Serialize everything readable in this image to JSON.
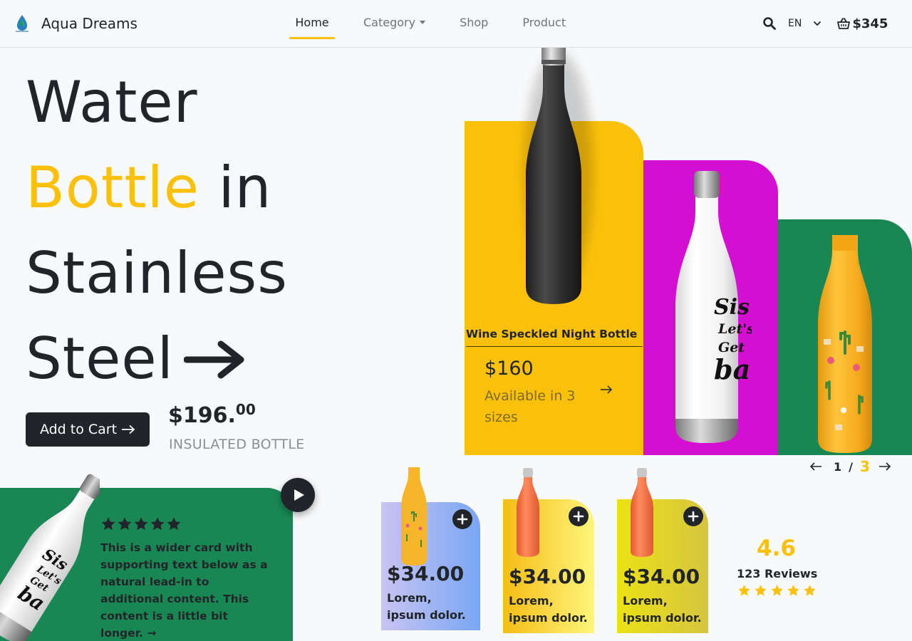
{
  "brand": {
    "name": "Aqua Dreams",
    "logo_icon": "leaf-drop-logo"
  },
  "nav": {
    "links": [
      {
        "label": "Home",
        "active": true
      },
      {
        "label": "Category",
        "has_dropdown": true
      },
      {
        "label": "Shop"
      },
      {
        "label": "Product"
      }
    ],
    "language": "EN",
    "cart_total": "$345",
    "search_icon": "search-icon",
    "cart_icon": "basket-icon"
  },
  "hero": {
    "line1": "Water",
    "line2_accent": "Bottle",
    "line2_rest": " in",
    "line3": "Stainless",
    "line4": "Steel",
    "add_to_cart": "Add to Cart",
    "price_main": "$196.",
    "price_cents": "00",
    "price_label": "INSULATED BOTTLE"
  },
  "featured": {
    "name": "Wine Speckled Night Bottle",
    "price": "$160",
    "availability": "Available in 3 sizes"
  },
  "pager": {
    "current": "1",
    "separator": "/",
    "total": "3"
  },
  "review": {
    "stars": 5,
    "text": "This is a wider card with supporting text below as a natural lead-in to additional content. This content is a little bit longer. →"
  },
  "products": [
    {
      "price": "$34.00",
      "desc": "Lorem, ipsum dolor."
    },
    {
      "price": "$34.00",
      "desc": "Lorem, ipsum dolor."
    },
    {
      "price": "$34.00",
      "desc": "Lorem, ipsum dolor."
    }
  ],
  "rating": {
    "value": "4.6",
    "count": "123 Reviews",
    "stars": 5
  },
  "colors": {
    "accent_yellow": "#fbc10a",
    "magenta": "#d40fd1",
    "green": "#198754",
    "dark": "#212529",
    "background": "#f8f9fa"
  }
}
